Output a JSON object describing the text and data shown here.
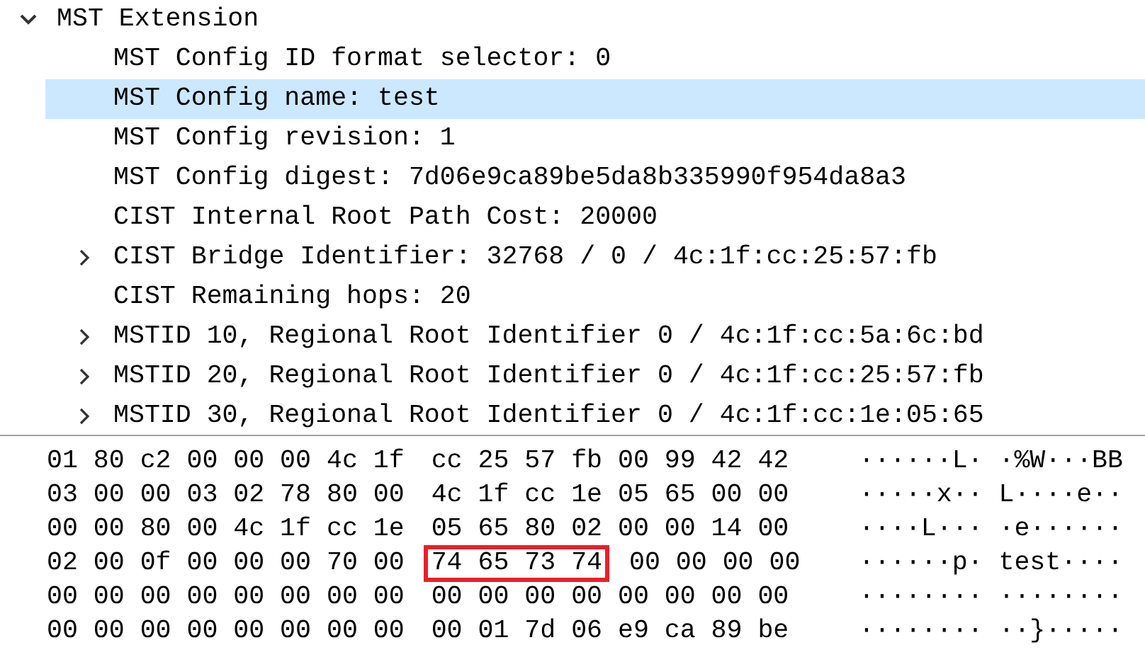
{
  "tree": [
    {
      "label": "MST Extension",
      "selected": false,
      "expanded": true,
      "children": [
        {
          "label": "MST Config ID format selector: 0",
          "selected": false
        },
        {
          "label": "MST Config name: test",
          "selected": true
        },
        {
          "label": "MST Config revision: 1",
          "selected": false
        },
        {
          "label": "MST Config digest: 7d06e9ca89be5da8b335990f954da8a3",
          "selected": false
        },
        {
          "label": "CIST Internal Root Path Cost: 20000",
          "selected": false
        },
        {
          "label": "CIST Bridge Identifier: 32768 / 0 / 4c:1f:cc:25:57:fb",
          "selected": false,
          "expanded": false
        },
        {
          "label": "CIST Remaining hops: 20",
          "selected": false
        },
        {
          "label": "MSTID 10, Regional Root Identifier 0 / 4c:1f:cc:5a:6c:bd",
          "selected": false,
          "expanded": false
        },
        {
          "label": "MSTID 20, Regional Root Identifier 0 / 4c:1f:cc:25:57:fb",
          "selected": false,
          "expanded": false
        },
        {
          "label": "MSTID 30, Regional Root Identifier 0 / 4c:1f:cc:1e:05:65",
          "selected": false,
          "expanded": false
        }
      ]
    }
  ],
  "hex_rows": [
    {
      "bytes": [
        {
          "text": "01 80 c2 00 00 00 4c 1f",
          "highlighted": false
        },
        {
          "text": "cc 25 57 fb 00 99 42 42",
          "highlighted": false
        }
      ],
      "ascii": "······L· ·%W···BB"
    },
    {
      "bytes": [
        {
          "text": "03 00 00 03 02 78 80 00",
          "highlighted": false
        },
        {
          "text": "4c 1f cc 1e 05 65 00 00",
          "highlighted": false
        }
      ],
      "ascii": "·····x·· L····e··"
    },
    {
      "bytes": [
        {
          "text": "00 00 80 00 4c 1f cc 1e",
          "highlighted": false
        },
        {
          "text": "05 65 80 02 00 00 14 00",
          "highlighted": false
        }
      ],
      "ascii": "····L··· ·e······"
    },
    {
      "bytes": [
        {
          "text": "02 00 0f 00 00 00 70 00",
          "highlighted": false
        },
        {
          "text": "74 65 73 74",
          "highlighted": true
        },
        {
          "text": "00 00 00 00",
          "highlighted": false
        }
      ],
      "ascii": "······p· test····"
    },
    {
      "bytes": [
        {
          "text": "00 00 00 00 00 00 00 00",
          "highlighted": false
        },
        {
          "text": "00 00 00 00 00 00 00 00",
          "highlighted": false
        }
      ],
      "ascii": "········ ········"
    },
    {
      "bytes": [
        {
          "text": "00 00 00 00 00 00 00 00",
          "highlighted": false
        },
        {
          "text": "00 01 7d 06 e9 ca 89 be",
          "highlighted": false
        }
      ],
      "ascii": "········ ··}·····"
    }
  ]
}
